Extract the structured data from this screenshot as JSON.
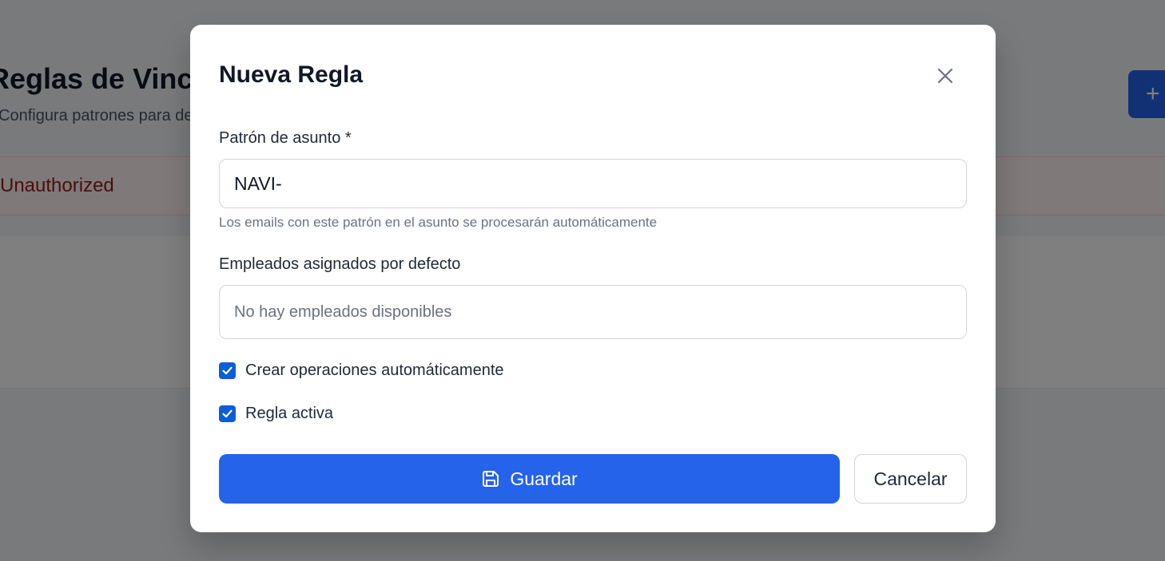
{
  "background": {
    "title": "Reglas de Vincu",
    "subtitle": "Configura patrones para dete",
    "error_text": "Unauthorized",
    "new_button_label": "+"
  },
  "modal": {
    "title": "Nueva Regla",
    "close_icon": "close-icon",
    "subject_pattern": {
      "label": "Patrón de asunto *",
      "value": "NAVI-",
      "hint": "Los emails con este patrón en el asunto se procesarán automáticamente"
    },
    "employees": {
      "label": "Empleados asignados por defecto",
      "empty_text": "No hay empleados disponibles"
    },
    "checkboxes": [
      {
        "label": "Crear operaciones automáticamente",
        "checked": true
      },
      {
        "label": "Regla activa",
        "checked": true
      }
    ],
    "save_button": {
      "label": "Guardar",
      "icon": "save-icon"
    },
    "cancel_button": {
      "label": "Cancelar"
    }
  },
  "colors": {
    "primary": "#2563eb",
    "checkbox": "#0b5ed7",
    "overlay": "rgba(0,0,0,0.5)",
    "error_text": "#991b1b"
  }
}
